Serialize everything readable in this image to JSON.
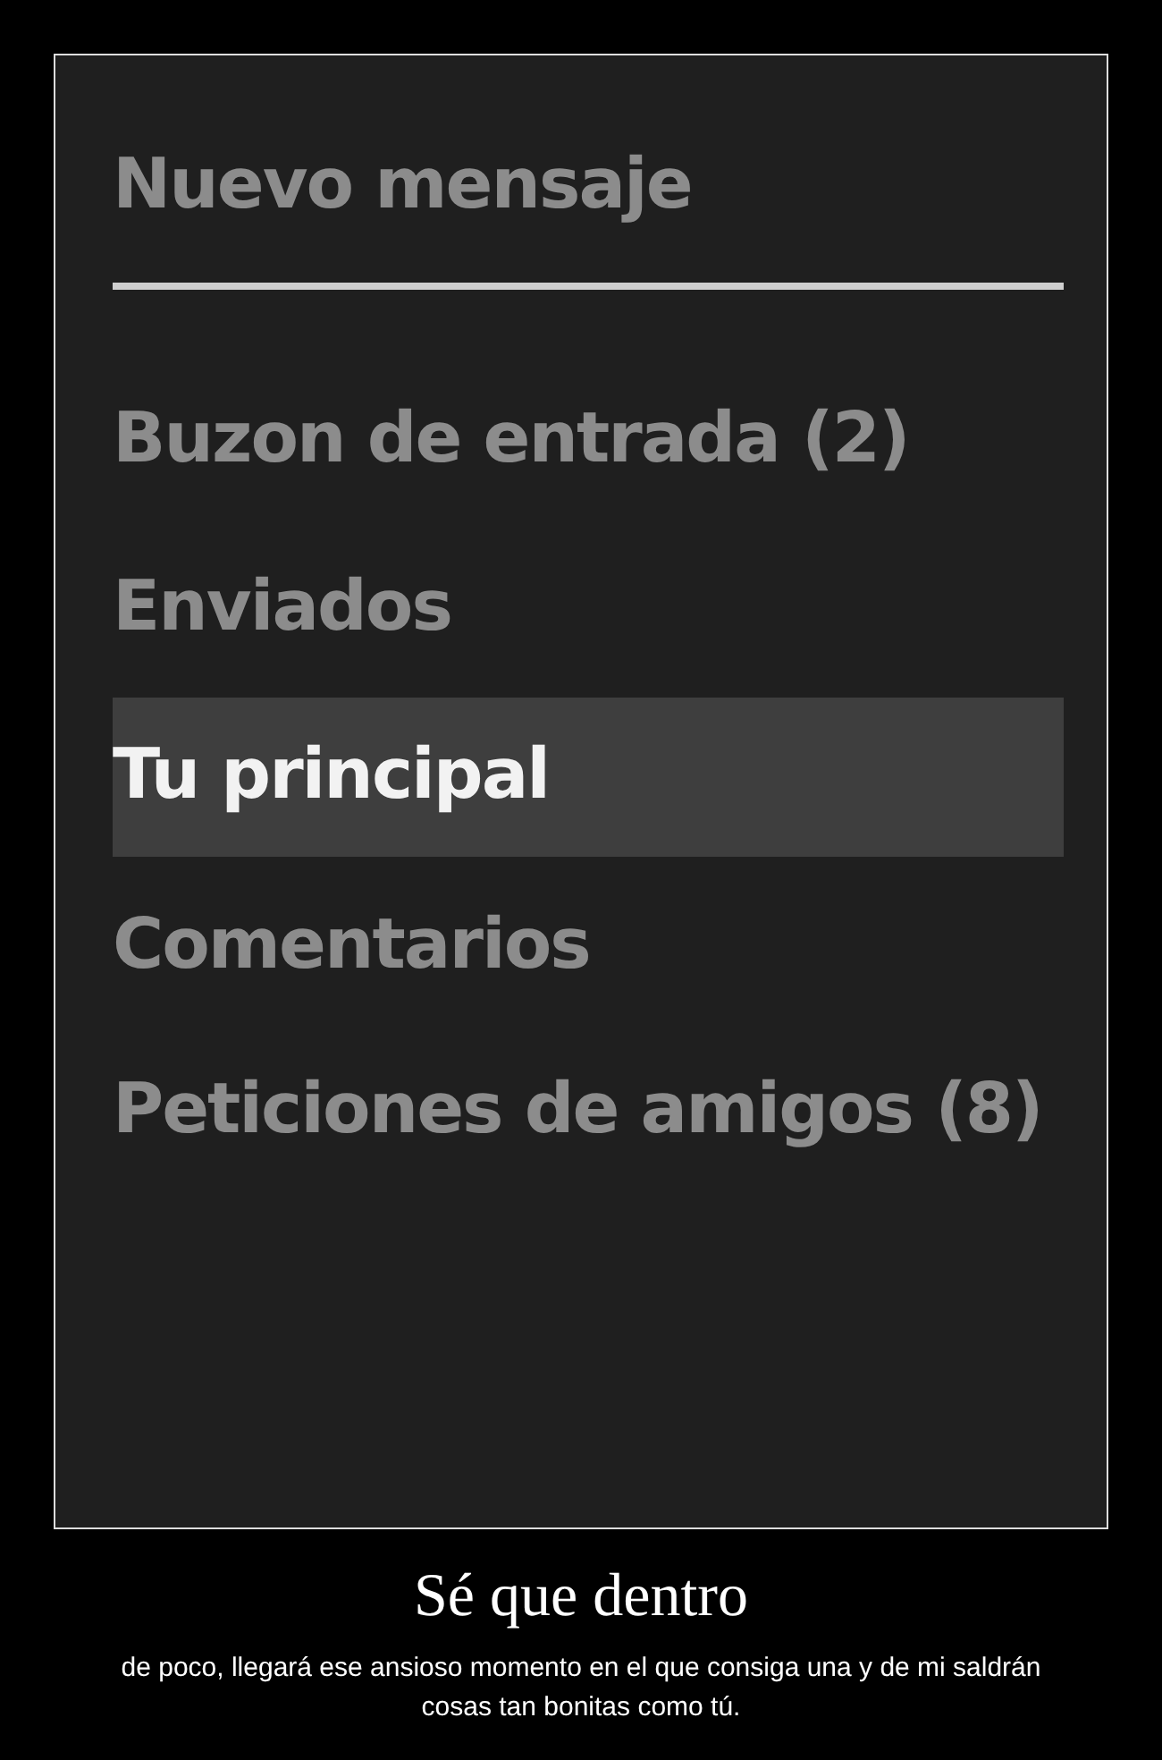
{
  "menu": {
    "title": "Nuevo mensaje",
    "items": [
      {
        "label": "Buzon de entrada (2)",
        "selected": false
      },
      {
        "label": "Enviados",
        "selected": false
      },
      {
        "label": "Tu principal",
        "selected": true
      },
      {
        "label": "Comentarios",
        "selected": false
      },
      {
        "label": "Peticiones de amigos (8)",
        "selected": false
      }
    ]
  },
  "caption": {
    "title": "Sé que dentro",
    "text": "de poco, llegará ese ansioso momento en el que consiga una y de mi saldrán cosas tan bonitas como tú."
  }
}
